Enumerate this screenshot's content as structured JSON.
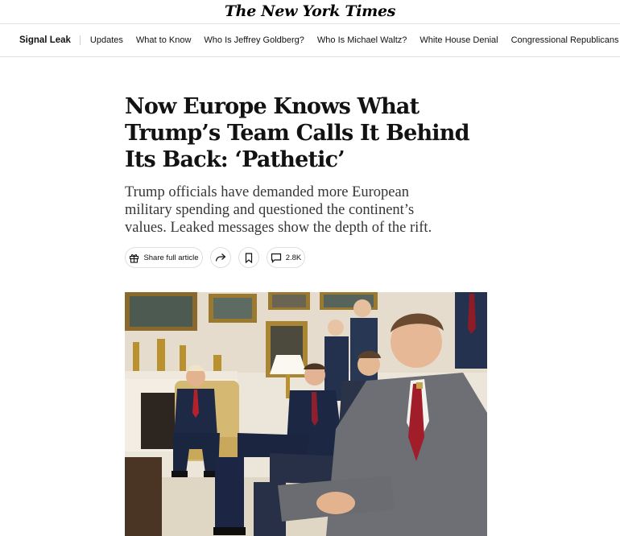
{
  "masthead": {
    "logo_text": "The New York Times"
  },
  "nav": {
    "section": "Signal Leak",
    "items": [
      "Updates",
      "What to Know",
      "Who Is Jeffrey Goldberg?",
      "Who Is Michael Waltz?",
      "White House Denial",
      "Congressional Republicans Shrug"
    ]
  },
  "article": {
    "headline": "Now Europe Knows What Trump’s Team Calls It Behind Its Back: ‘Pathetic’",
    "summary": "Trump officials have demanded more European military spending and questioned the continent’s values. Leaked messages show the depth of the rift."
  },
  "actions": {
    "share_full_label": "Share full article",
    "comments_count": "2.8K",
    "icons": [
      "gift-icon",
      "share-arrow-icon",
      "bookmark-icon",
      "comment-icon"
    ]
  },
  "colors": {
    "text": "#121212",
    "summary": "#363636",
    "border": "#dfdfdf"
  }
}
